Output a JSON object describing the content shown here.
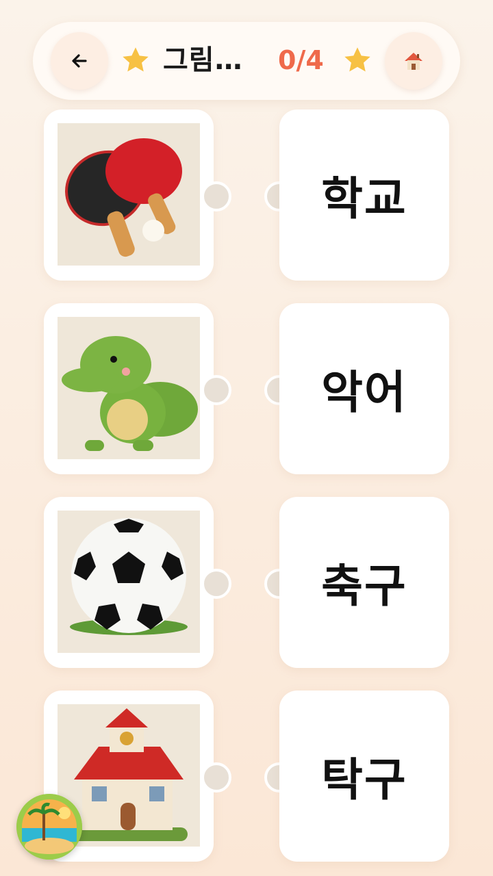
{
  "header": {
    "back_icon": "arrow-left-icon",
    "title": "그림…",
    "progress": "0/4",
    "home_icon": "house-icon",
    "star_color": "#f7c144",
    "progress_color": "#ef6a4b"
  },
  "pictures": [
    {
      "icon": "ping-pong-paddles-picture"
    },
    {
      "icon": "crocodile-plush-picture"
    },
    {
      "icon": "soccer-ball-picture"
    },
    {
      "icon": "school-house-picture"
    }
  ],
  "words": [
    "학교",
    "악어",
    "축구",
    "탁구"
  ],
  "avatar": {
    "icon": "beach-avatar-icon"
  }
}
